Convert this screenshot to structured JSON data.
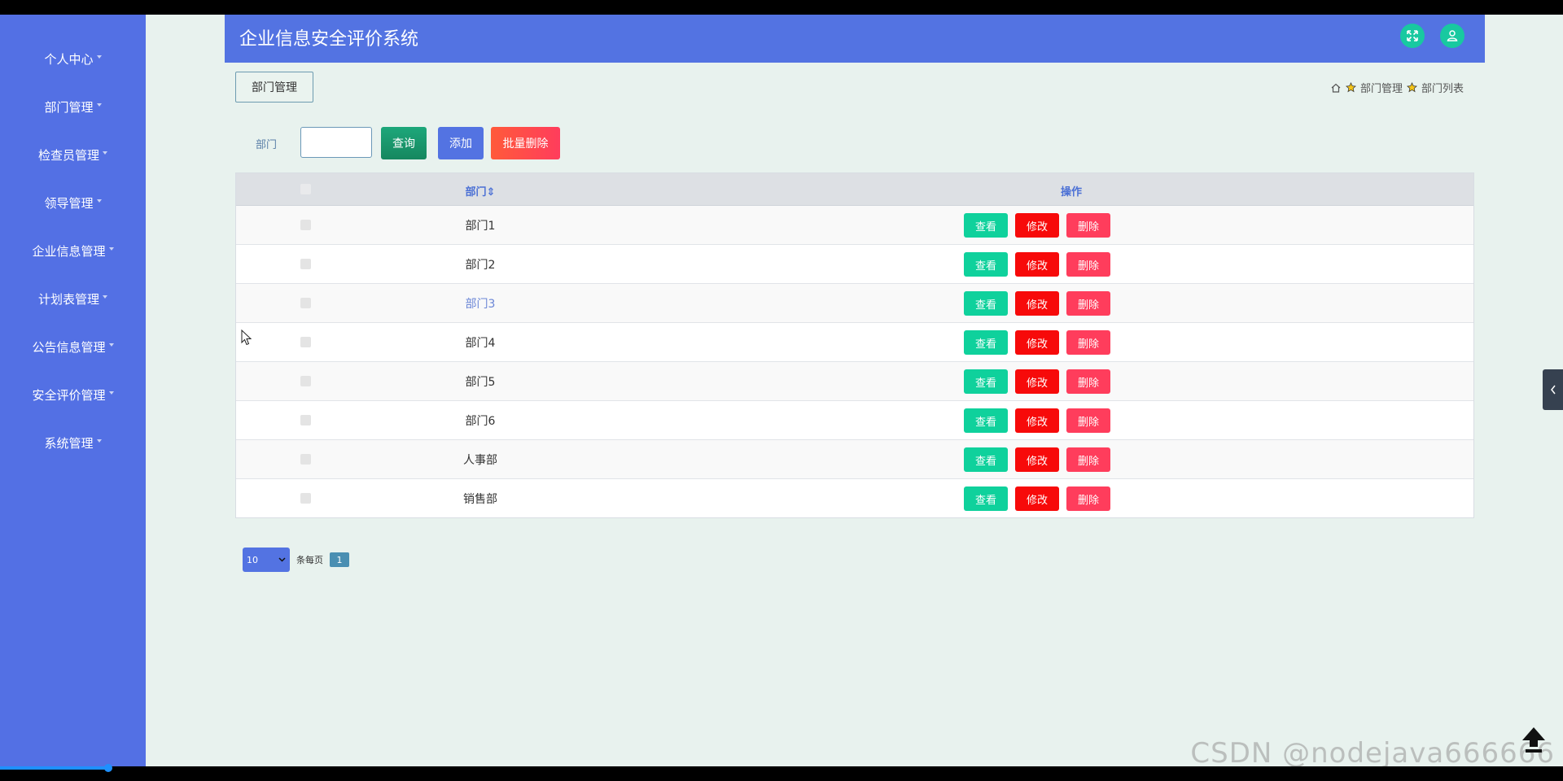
{
  "app": {
    "title": "企业信息安全评价系统"
  },
  "sidebar": {
    "items": [
      {
        "label": "个人中心"
      },
      {
        "label": "部门管理"
      },
      {
        "label": "检查员管理"
      },
      {
        "label": "领导管理"
      },
      {
        "label": "企业信息管理"
      },
      {
        "label": "计划表管理"
      },
      {
        "label": "公告信息管理"
      },
      {
        "label": "安全评价管理"
      },
      {
        "label": "系统管理"
      }
    ]
  },
  "page": {
    "tag": "部门管理",
    "breadcrumb": [
      "部门管理",
      "部门列表"
    ]
  },
  "search": {
    "label": "部门",
    "value": "",
    "query_button": "查询",
    "add_button": "添加",
    "batch_delete_button": "批量删除"
  },
  "table": {
    "columns": [
      "部门",
      "操作"
    ],
    "sort_indicator": "⇕",
    "rows": [
      {
        "dept": "部门1"
      },
      {
        "dept": "部门2"
      },
      {
        "dept": "部门3"
      },
      {
        "dept": "部门4"
      },
      {
        "dept": "部门5"
      },
      {
        "dept": "部门6"
      },
      {
        "dept": "人事部"
      },
      {
        "dept": "销售部"
      }
    ],
    "actions": {
      "view": "查看",
      "edit": "修改",
      "delete": "删除"
    }
  },
  "pager": {
    "page_size": "10",
    "per_page_label": "条每页",
    "current_page": "1"
  },
  "watermark": "CSDN @nodejava666666",
  "colors": {
    "sidebar": "#5370e4",
    "topbar": "#5373e2",
    "view_button": "#0fd19c",
    "edit_button": "#f70a0a",
    "delete_button": "#ff3d5c",
    "query_button": "#1a9a6e",
    "batch_delete_button": "#ff4a3d"
  },
  "hover_row_index": 2
}
